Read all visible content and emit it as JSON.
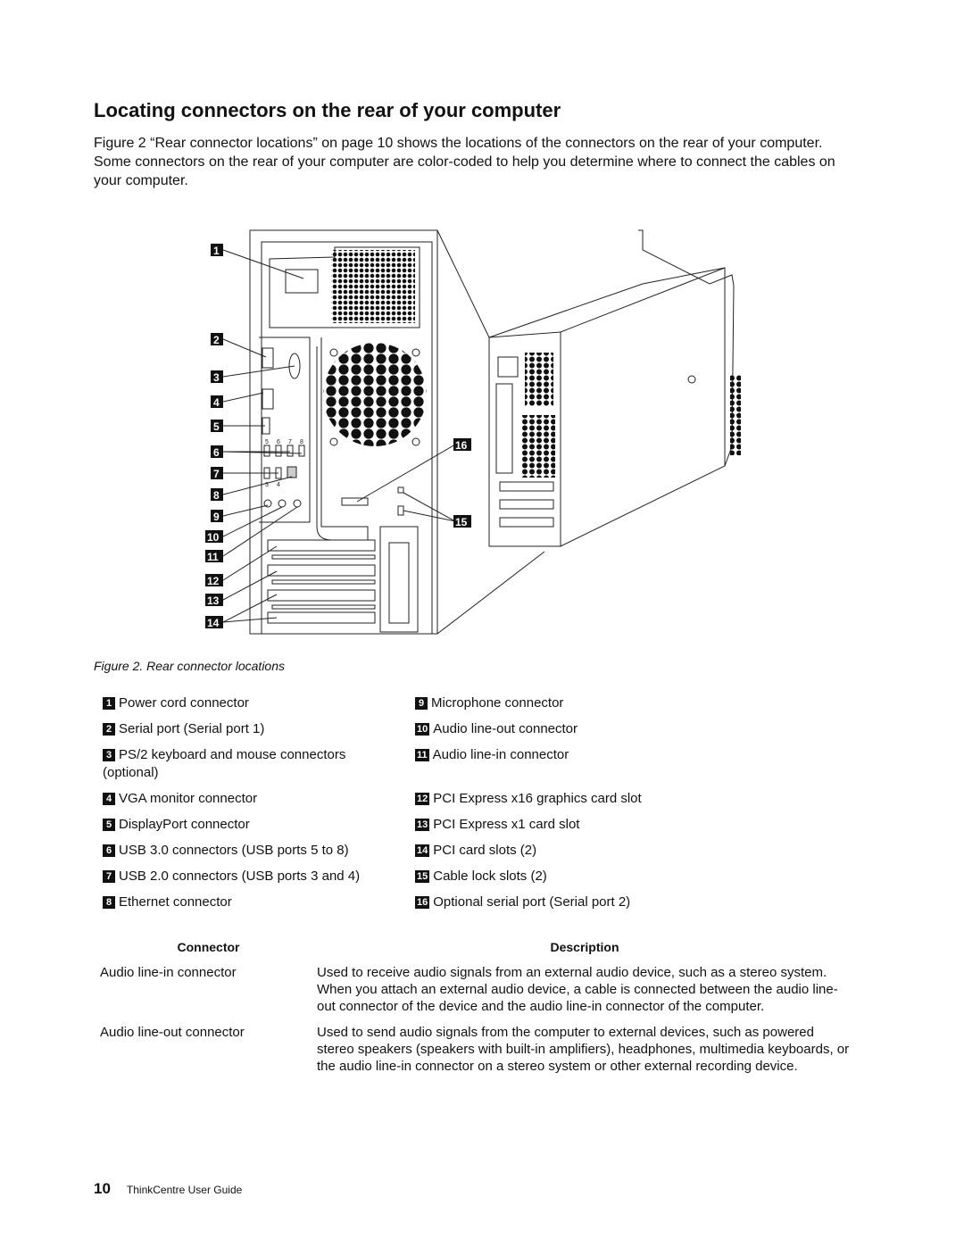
{
  "page": {
    "title": "Locating connectors on the rear of your computer",
    "intro": "Figure 2 “Rear connector locations” on page 10 shows the locations of the connectors on the rear of your computer. Some connectors on the rear of your computer are color-coded to help you determine where to connect the cables on your computer."
  },
  "figure": {
    "callouts": [
      "1",
      "2",
      "3",
      "4",
      "5",
      "6",
      "7",
      "8",
      "9",
      "10",
      "11",
      "12",
      "13",
      "14",
      "15",
      "16"
    ],
    "usb_port_numbers": [
      "5",
      "6",
      "7",
      "8",
      "3",
      "4"
    ],
    "caption": "Figure 2.  Rear connector locations"
  },
  "legend": {
    "left": [
      {
        "num": "1",
        "label": "Power cord connector"
      },
      {
        "num": "2",
        "label": "Serial port (Serial port 1)"
      },
      {
        "num": "3",
        "label": "PS/2 keyboard and mouse connectors (optional)"
      },
      {
        "num": "4",
        "label": "VGA monitor connector"
      },
      {
        "num": "5",
        "label": "DisplayPort connector"
      },
      {
        "num": "6",
        "label": "USB 3.0 connectors (USB ports 5 to 8)"
      },
      {
        "num": "7",
        "label": "USB 2.0 connectors (USB ports 3 and 4)"
      },
      {
        "num": "8",
        "label": "Ethernet connector"
      }
    ],
    "right": [
      {
        "num": "9",
        "label": "Microphone connector"
      },
      {
        "num": "10",
        "label": "Audio line-out connector"
      },
      {
        "num": "11",
        "label": "Audio line-in connector"
      },
      {
        "num": "12",
        "label": "PCI Express x16 graphics card slot"
      },
      {
        "num": "13",
        "label": "PCI Express x1 card slot"
      },
      {
        "num": "14",
        "label": "PCI card slots (2)"
      },
      {
        "num": "15",
        "label": "Cable lock slots (2)"
      },
      {
        "num": "16",
        "label": "Optional serial port (Serial port 2)"
      }
    ]
  },
  "table": {
    "headers": [
      "Connector",
      "Description"
    ],
    "rows": [
      {
        "connector": "Audio line-in connector",
        "description": "Used to receive audio signals from an external audio device, such as a stereo system. When you attach an external audio device, a cable is connected between the audio line-out connector of the device and the audio line-in connector of the computer."
      },
      {
        "connector": "Audio line-out connector",
        "description": "Used to send audio signals from the computer to external devices, such as powered stereo speakers (speakers with built-in amplifiers), headphones, multimedia keyboards, or the audio line-in connector on a stereo system or other external recording device."
      }
    ]
  },
  "footer": {
    "page_number": "10",
    "guide_title": "ThinkCentre User Guide"
  }
}
